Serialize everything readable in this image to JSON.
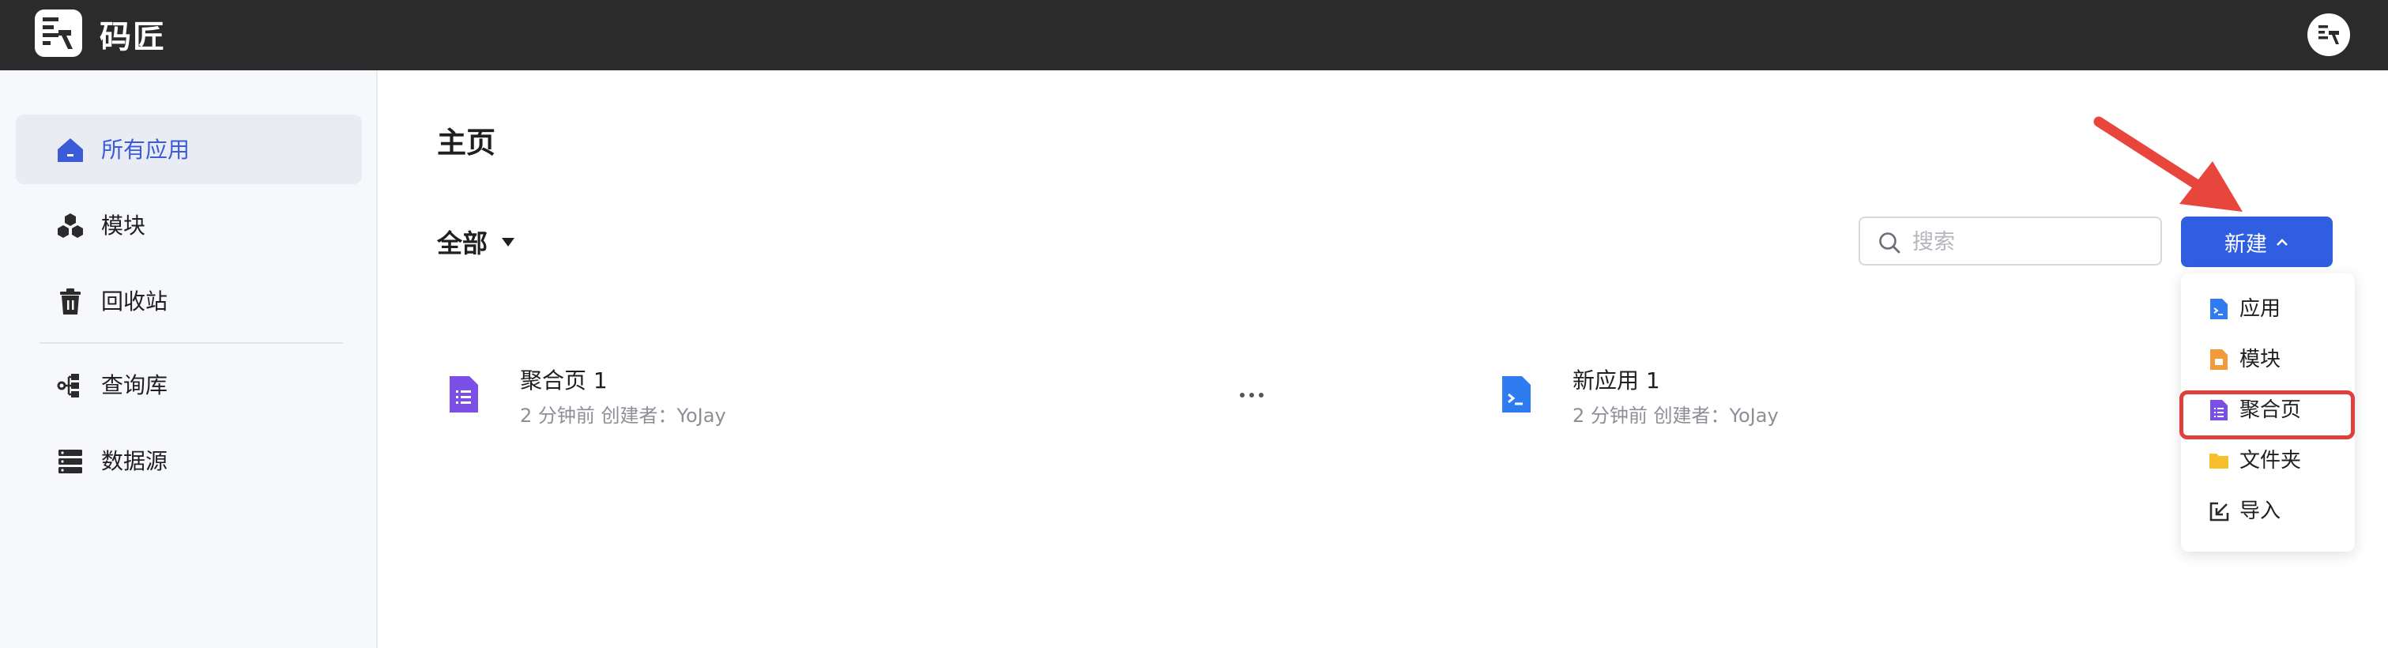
{
  "app": {
    "name": "码匠"
  },
  "sidebar": {
    "items": [
      {
        "label": "所有应用",
        "icon": "home-icon",
        "active": true
      },
      {
        "label": "模块",
        "icon": "module-icon",
        "active": false
      },
      {
        "label": "回收站",
        "icon": "trash-icon",
        "active": false
      },
      {
        "label": "查询库",
        "icon": "query-library-icon",
        "active": false
      },
      {
        "label": "数据源",
        "icon": "database-icon",
        "active": false
      }
    ]
  },
  "main": {
    "title": "主页",
    "filter": {
      "label": "全部"
    },
    "search": {
      "placeholder": "搜索",
      "value": ""
    },
    "new_button": {
      "label": "新建"
    },
    "new_menu": {
      "items": [
        {
          "label": "应用",
          "icon": "app-file-icon"
        },
        {
          "label": "模块",
          "icon": "module-file-icon"
        },
        {
          "label": "聚合页",
          "icon": "aggregate-page-icon",
          "highlighted": true
        },
        {
          "label": "文件夹",
          "icon": "folder-icon"
        },
        {
          "label": "导入",
          "icon": "import-icon"
        }
      ]
    },
    "cards": [
      {
        "title": "聚合页 1",
        "meta": "2 分钟前 创建者：YoJay",
        "icon": "aggregate-page-icon"
      },
      {
        "title": "新应用 1",
        "meta": "2 分钟前 创建者：YoJay",
        "icon": "app-file-icon"
      }
    ]
  },
  "colors": {
    "topbar": "#2b2b2b",
    "accent": "#2f5fe0",
    "active_nav_text": "#3b5bdb",
    "annotation_red": "#e0403d",
    "aggregate_purple": "#7b4fe6",
    "app_blue": "#2f7cf0",
    "module_orange": "#f39a3a",
    "folder_yellow": "#f5c02a"
  }
}
